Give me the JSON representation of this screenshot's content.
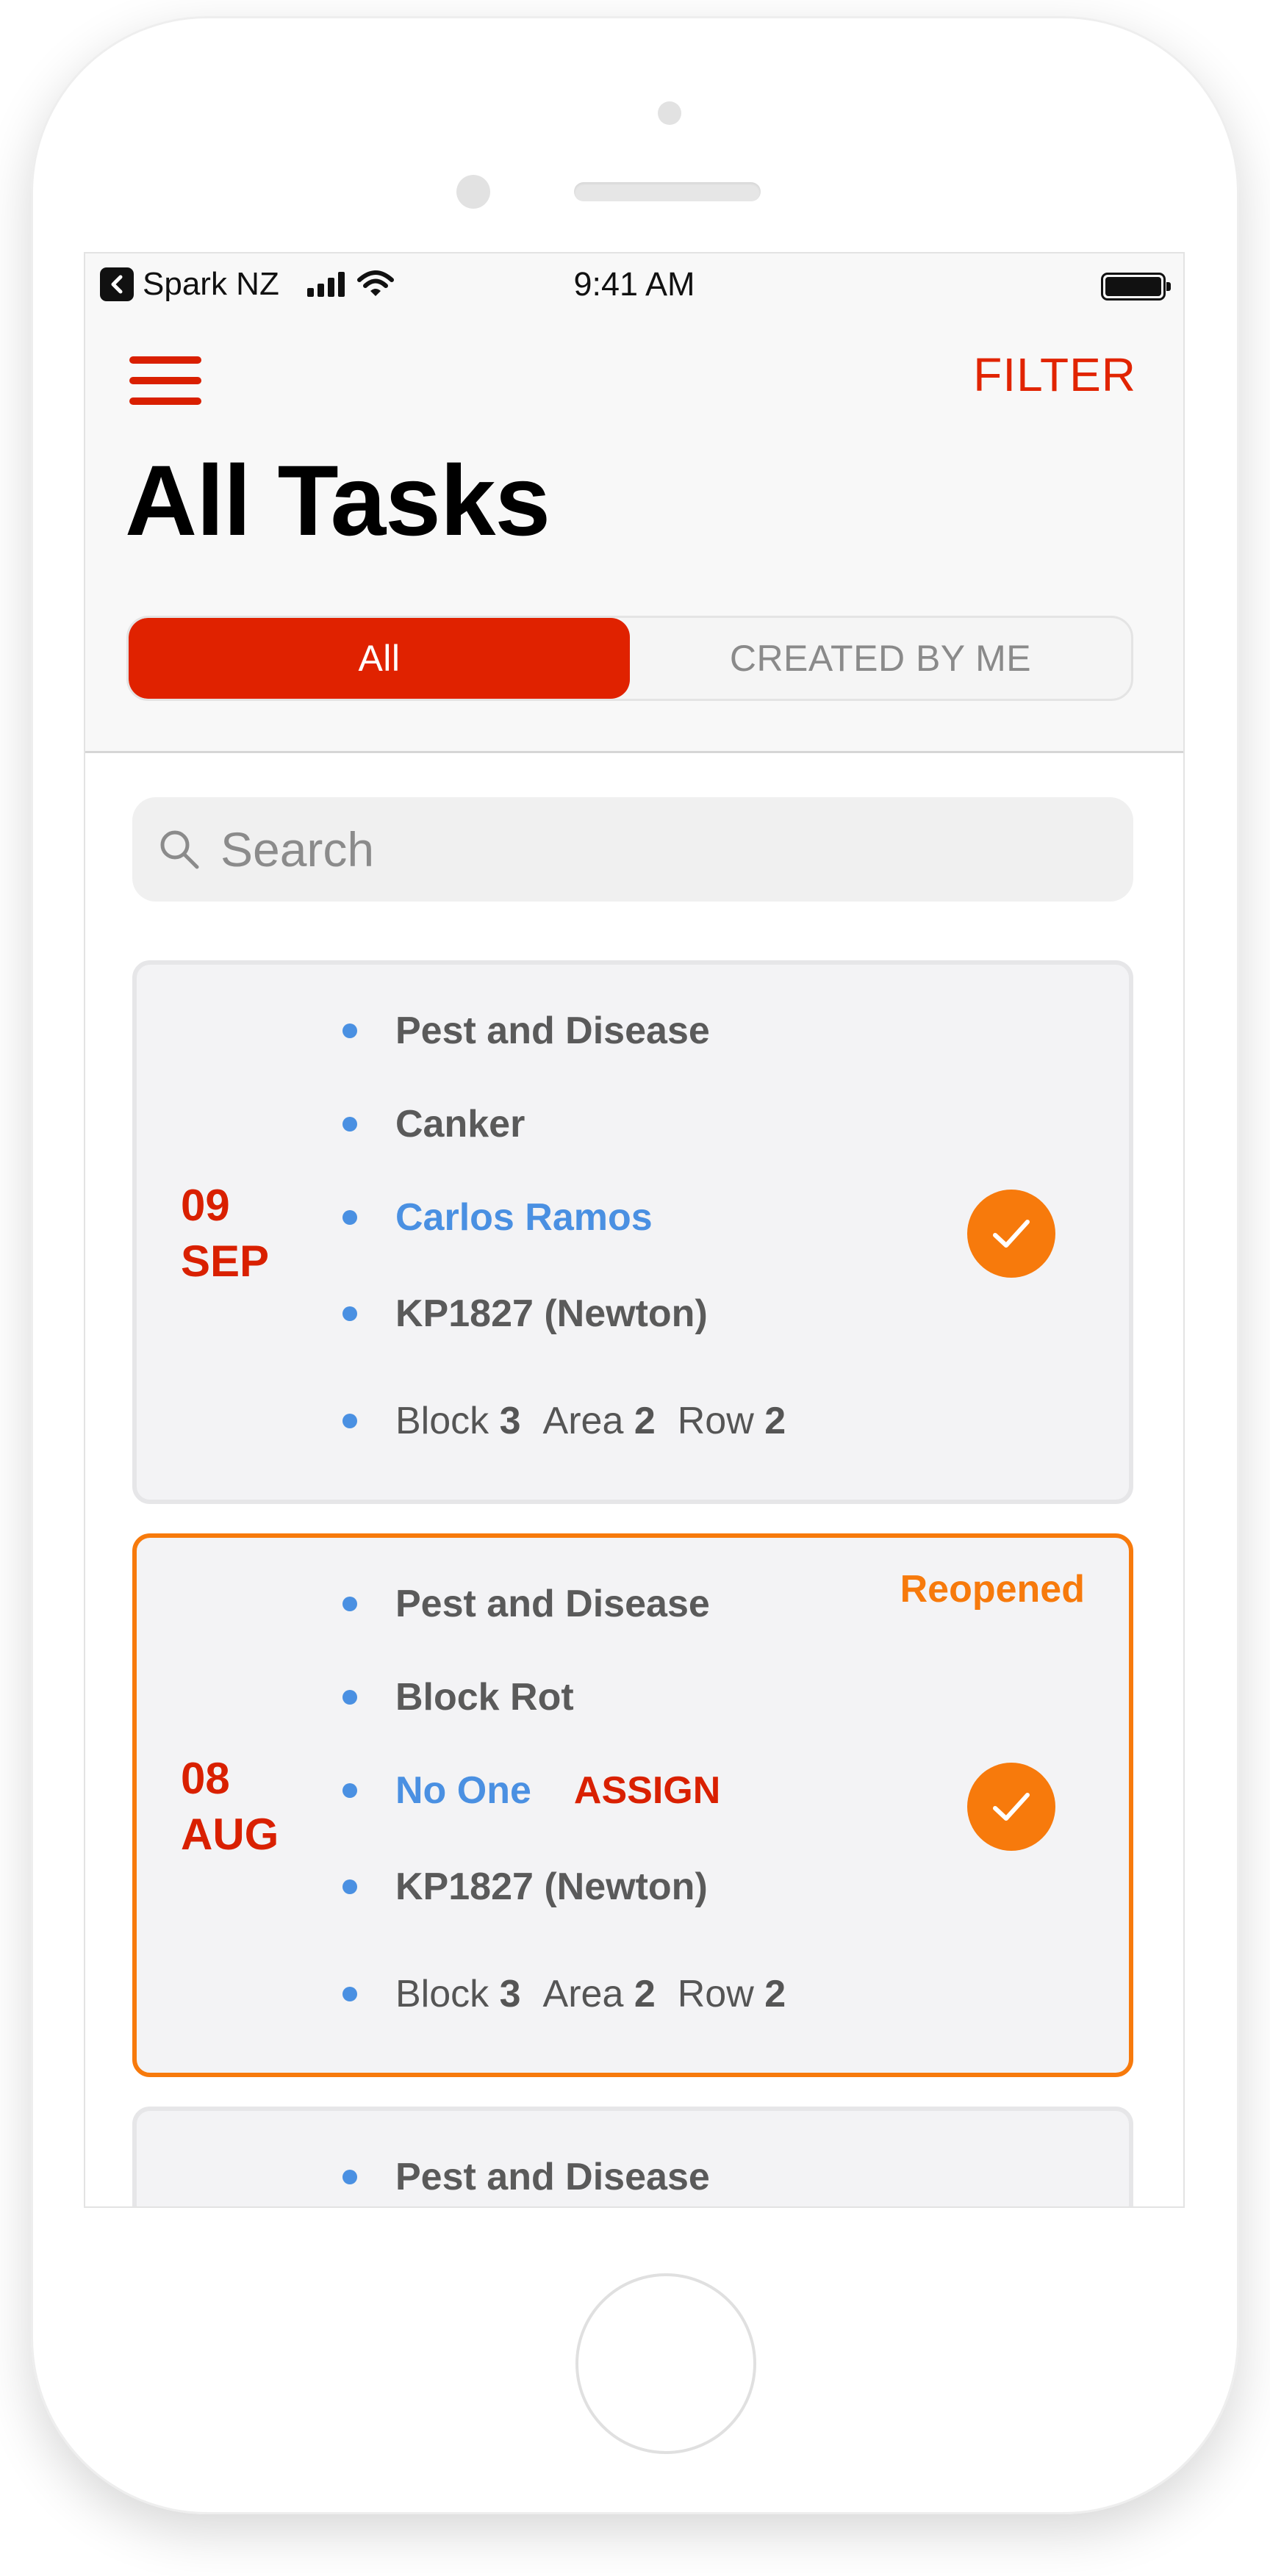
{
  "status_bar": {
    "carrier": "Spark NZ",
    "time": "9:41 AM"
  },
  "header": {
    "title": "All Tasks",
    "filter_label": "FILTER",
    "menu_icon": "hamburger-menu-icon"
  },
  "segments": [
    {
      "label": "All",
      "active": true
    },
    {
      "label": "CREATED BY ME",
      "active": false
    }
  ],
  "search": {
    "placeholder": "Search"
  },
  "tasks": [
    {
      "day": "09",
      "month": "SEP",
      "category": "Pest and Disease",
      "issue": "Canker",
      "assignee": "Carlos Ramos",
      "location": "KP1827 (Newton)",
      "block_label": "Block",
      "block": "3",
      "area_label": "Area",
      "area": "2",
      "row_label": "Row",
      "row": "2"
    },
    {
      "day": "08",
      "month": "AUG",
      "status": "Reopened",
      "category": "Pest and Disease",
      "issue": "Block Rot",
      "assignee": "No One",
      "assign_label": "ASSIGN",
      "location": "KP1827 (Newton)",
      "block_label": "Block",
      "block": "3",
      "area_label": "Area",
      "area": "2",
      "row_label": "Row",
      "row": "2"
    },
    {
      "category": "Pest and Disease"
    }
  ],
  "colors": {
    "accent_red": "#e02200",
    "accent_orange": "#f77a0c",
    "link_blue": "#4a90e2"
  }
}
